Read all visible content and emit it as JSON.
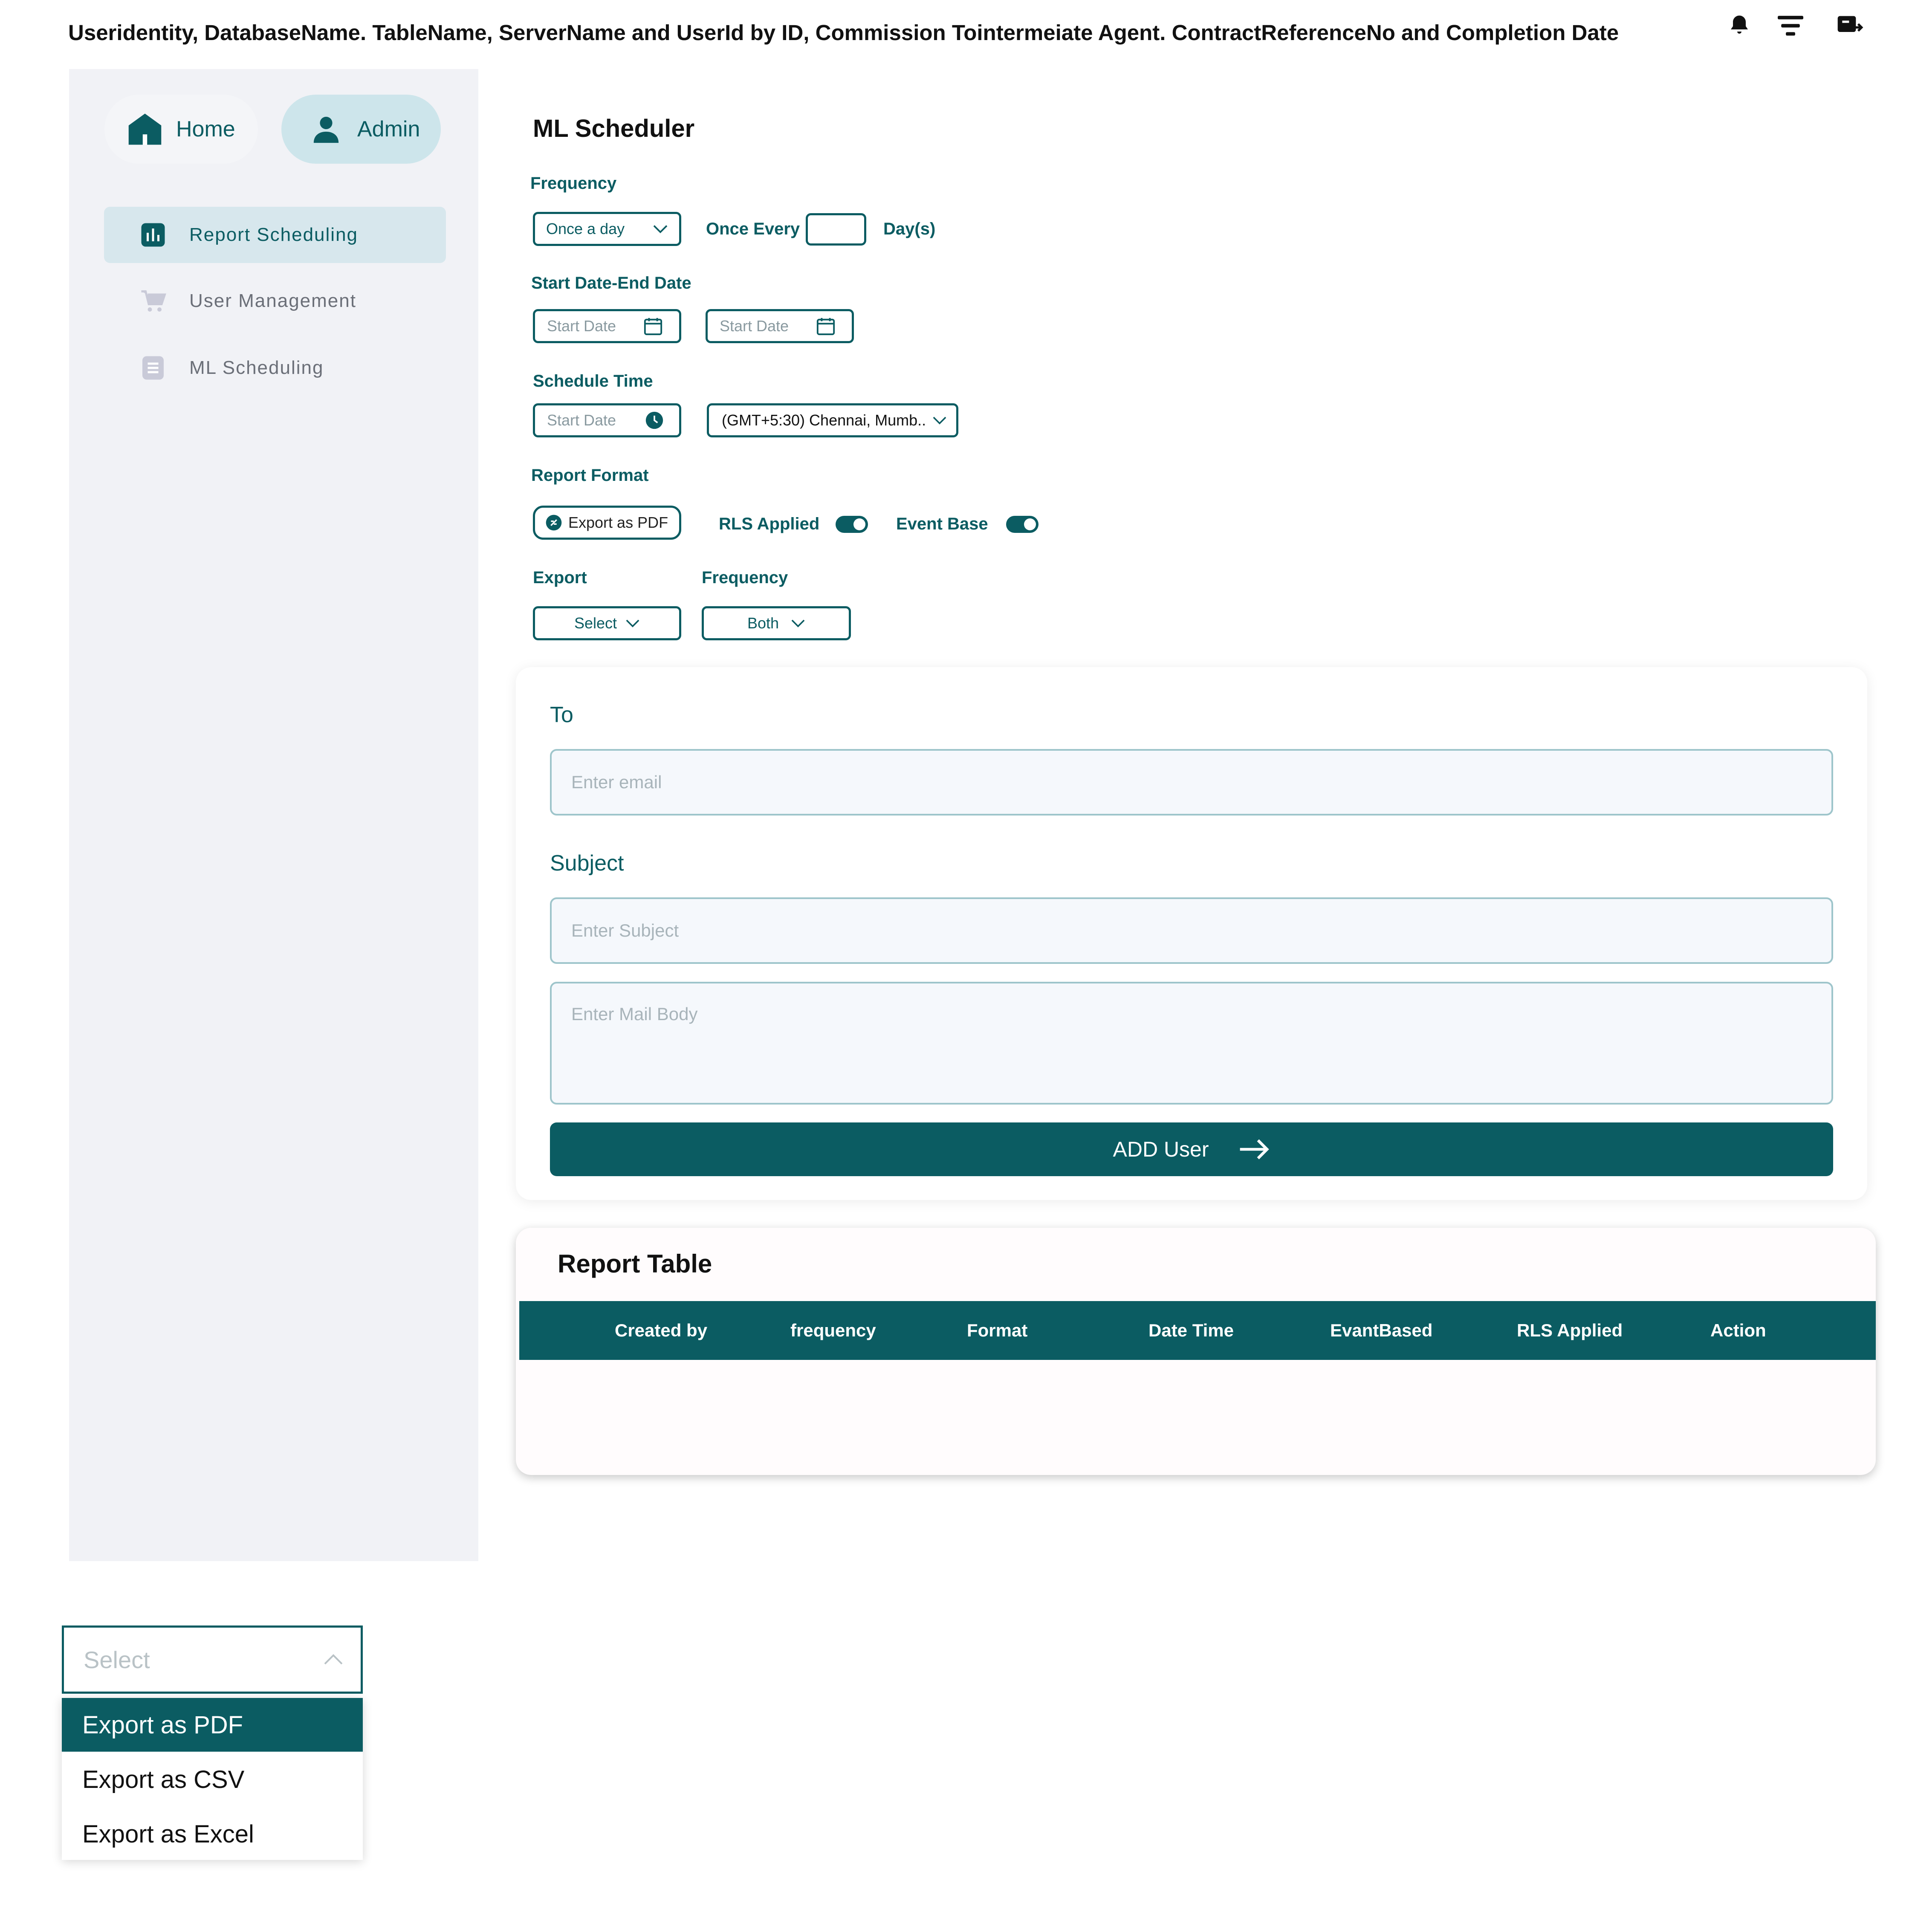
{
  "header": {
    "title": "Useridentity, DatabaseName. TableName, ServerName and UserId by ID, Commission Tointermeiate Agent. ContractReferenceNo and Completion Date",
    "icons": [
      "bell-icon",
      "filter-icon",
      "logout-icon"
    ]
  },
  "sidebar": {
    "home_label": "Home",
    "admin_label": "Admin",
    "items": [
      {
        "label": "Report Scheduling",
        "icon": "chart-icon",
        "active": true
      },
      {
        "label": "User Management",
        "icon": "cart-icon",
        "active": false
      },
      {
        "label": "ML Scheduling",
        "icon": "document-icon",
        "active": false
      }
    ]
  },
  "form": {
    "title": "ML Scheduler",
    "frequency_label": "Frequency",
    "frequency_value": "Once a day",
    "once_every_label": "Once Every",
    "once_every_value": "",
    "days_label": "Day(s)",
    "date_range_label": "Start Date-End Date",
    "start_date_placeholder": "Start Date",
    "end_date_placeholder": "Start Date",
    "schedule_time_label": "Schedule Time",
    "time_placeholder": "Start Date",
    "timezone_value": "(GMT+5:30) Chennai, Mumb..",
    "report_format_label": "Report Format",
    "report_format_value": "Export as PDF",
    "rls_label": "RLS Applied",
    "rls_on": true,
    "event_label": "Event Base",
    "event_on": true,
    "export_label": "Export",
    "export_value": "Select",
    "frequency2_label": "Frequency",
    "frequency2_value": "Both"
  },
  "email": {
    "to_label": "To",
    "to_placeholder": "Enter email",
    "subject_label": "Subject",
    "subject_placeholder": "Enter Subject",
    "body_placeholder": "Enter Mail Body",
    "add_button": "ADD User"
  },
  "report_table": {
    "title": "Report Table",
    "columns": [
      "Created by",
      "frequency",
      "Format",
      "Date Time",
      "EvantBased",
      "RLS Applied",
      "Action"
    ],
    "rows": []
  },
  "dropdown": {
    "placeholder": "Select",
    "options": [
      "Export as PDF",
      "Export as CSV",
      "Export as Excel"
    ],
    "selected": "Export as PDF"
  },
  "colors": {
    "accent": "#0b5c62",
    "sidebar_bg": "#f1f2f6",
    "active_nav": "#d7e7ed",
    "admin_pill": "#cde5eb"
  }
}
